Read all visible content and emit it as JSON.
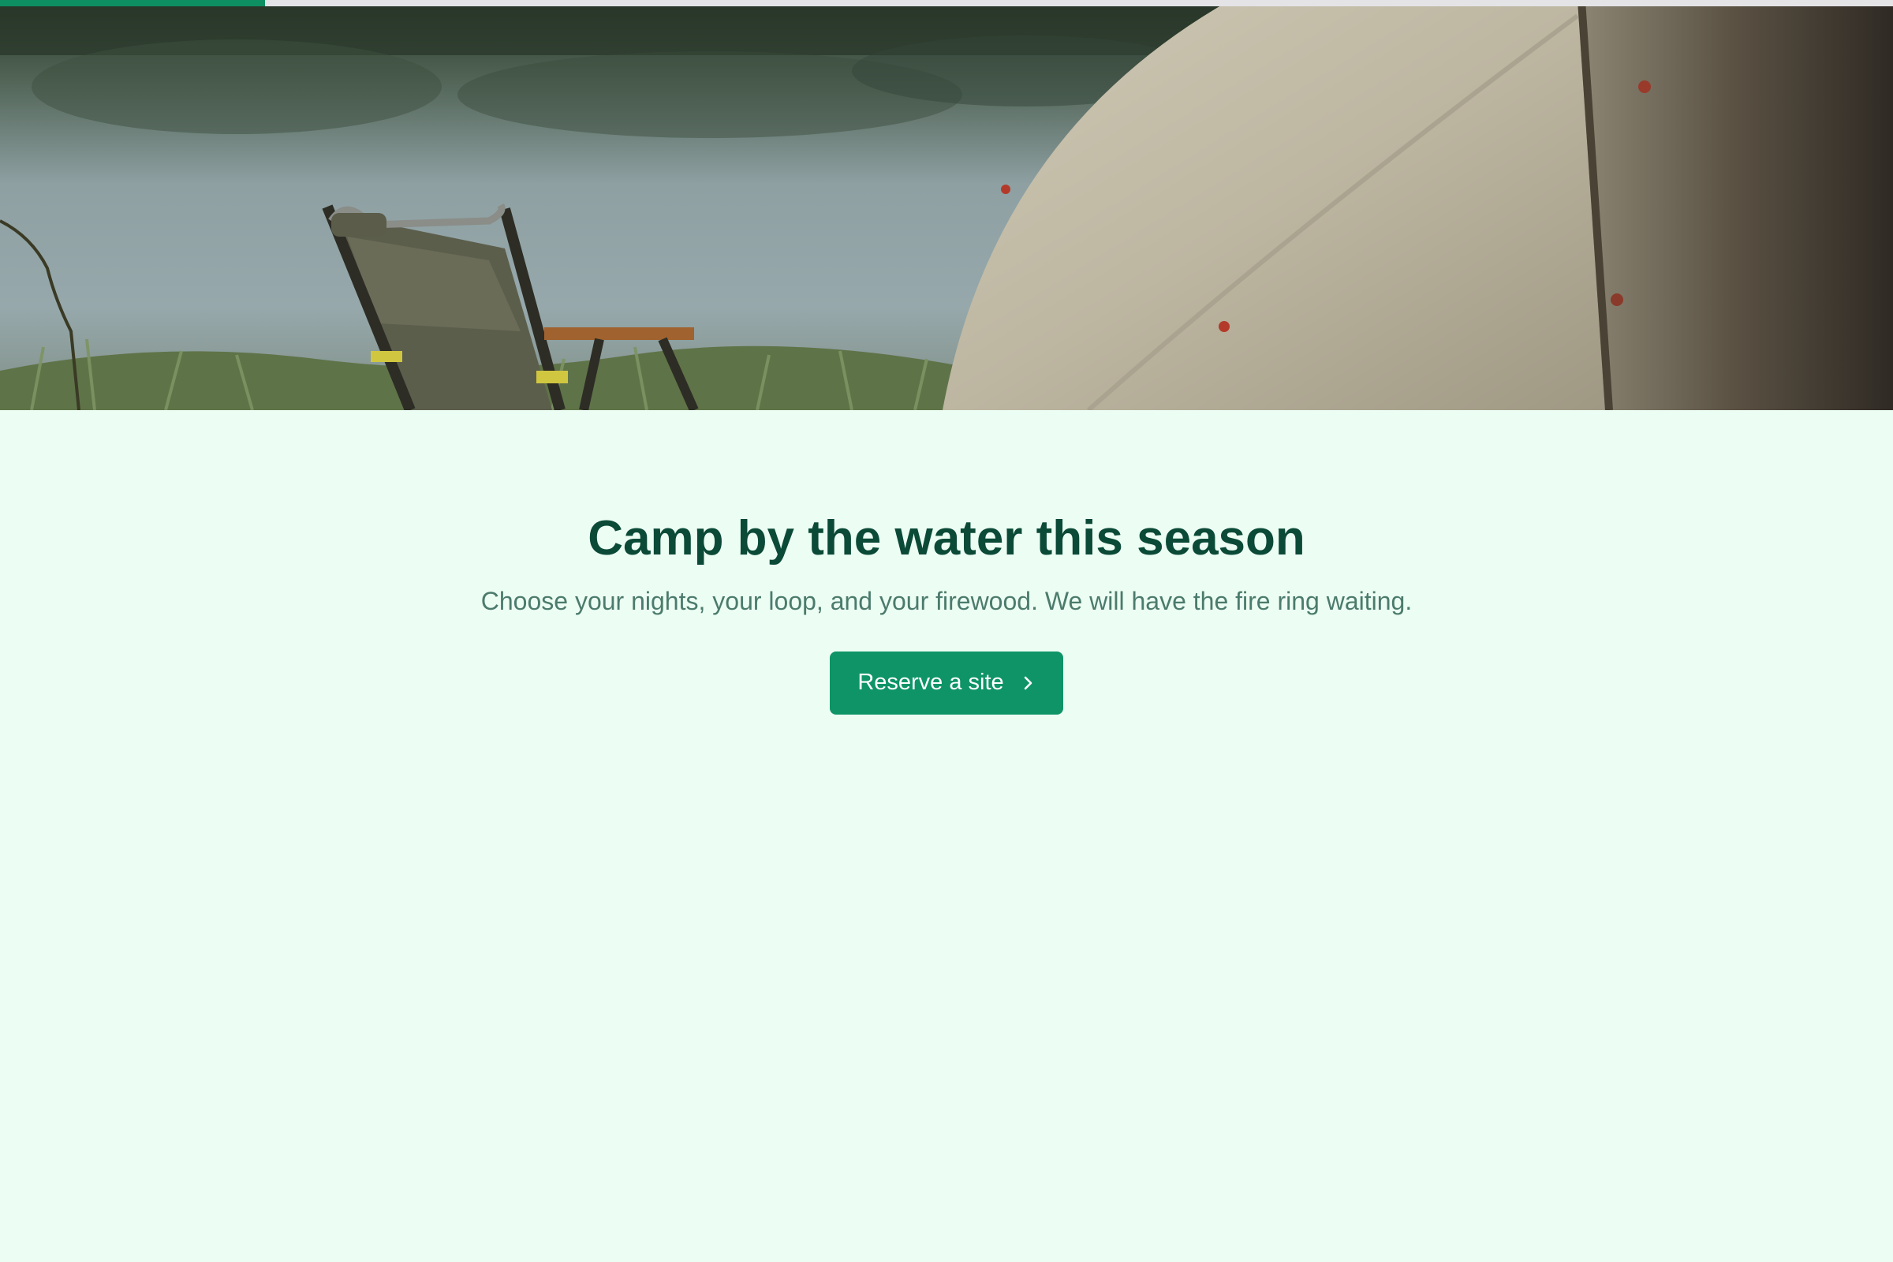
{
  "progress": {
    "fraction": 0.14,
    "color": "#0e8f61"
  },
  "hero": {
    "image": "lakeside-camp-chair-and-tent"
  },
  "main": {
    "title": "Camp by the water this season",
    "subtitle": "Choose your nights, your loop, and your firewood. We will have the fire ring waiting.",
    "cta_label": "Reserve a site",
    "cta_icon": "chevron-right-icon"
  },
  "colors": {
    "background": "#ecfdf3",
    "title": "#0b4a37",
    "subtitle": "#4b7b6c",
    "button": "#0e9467"
  }
}
